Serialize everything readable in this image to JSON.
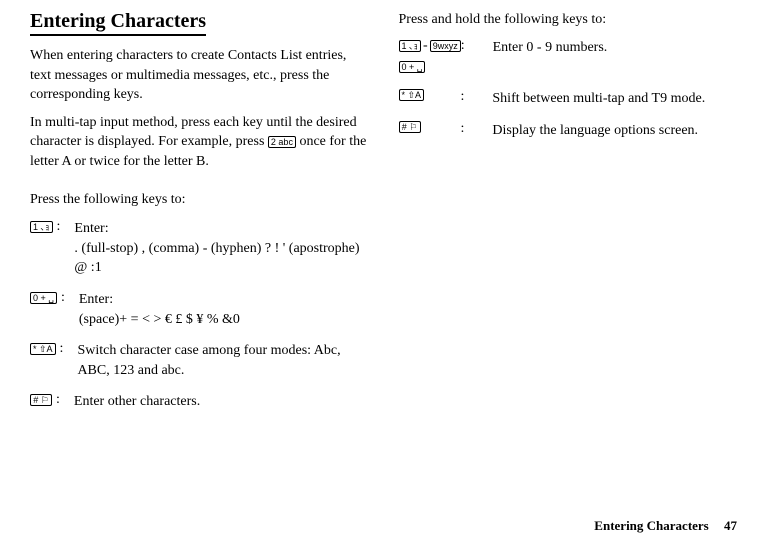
{
  "title": "Entering Characters",
  "paragraphs": {
    "intro1": "When entering characters to create Contacts List entries, text messages or multimedia messages, etc., press the corresponding keys.",
    "intro2_prefix": "In multi-tap input method, press each key until the desired character is displayed. For example, press ",
    "intro2_suffix": " once for the letter A or twice for the letter B."
  },
  "section1_heading": "Press the following keys to:",
  "col1": [
    {
      "key_label": "1 ､ｮ",
      "desc": "Enter:\n. (full-stop) , (comma) - (hyphen) ? ! ' (apostrophe) @ :1"
    },
    {
      "key_label": "0 + ␣",
      "desc": "Enter:\n(space)+ = < > € £ $ ¥ % &0"
    },
    {
      "key_label": "* ⇧A",
      "desc": "Switch character case among four modes: Abc, ABC, 123 and abc."
    },
    {
      "key_label": "# ⚐",
      "desc": "Enter other characters."
    }
  ],
  "section2_heading": "Press and hold the following keys to:",
  "col2": [
    {
      "key_from": "1 ､ｮ",
      "dash": "- ",
      "key_to": "9wxyz",
      "key_extra": "0 + ␣",
      "desc": "Enter 0 - 9 numbers."
    },
    {
      "key_from": "* ⇧A",
      "desc": "Shift between multi-tap and T9 mode."
    },
    {
      "key_from": "# ⚐",
      "desc": "Display the language options screen."
    }
  ],
  "inline_key": "2 abc",
  "footer_title": "Entering Characters",
  "footer_page": "47"
}
